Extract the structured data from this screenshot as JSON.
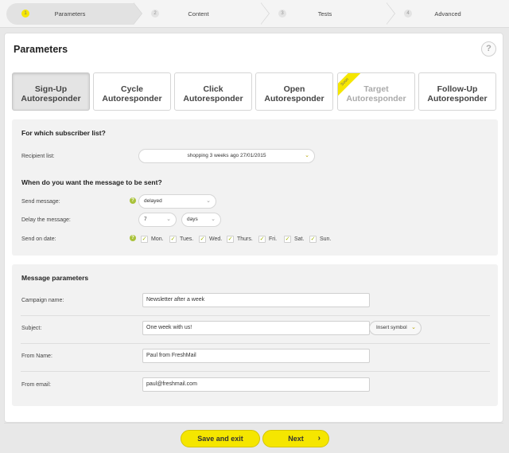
{
  "wizard": {
    "steps": [
      {
        "num": "1",
        "label": "Parameters"
      },
      {
        "num": "2",
        "label": "Content"
      },
      {
        "num": "3",
        "label": "Tests"
      },
      {
        "num": "4",
        "label": "Advanced"
      }
    ]
  },
  "page": {
    "title": "Parameters",
    "help_icon": "?"
  },
  "tiles": [
    {
      "line1": "Sign-Up",
      "line2": "Autoresponder"
    },
    {
      "line1": "Cycle",
      "line2": "Autoresponder"
    },
    {
      "line1": "Click",
      "line2": "Autoresponder"
    },
    {
      "line1": "Open",
      "line2": "Autoresponder"
    },
    {
      "line1": "Target",
      "line2": "Autoresponder",
      "ribbon": "Soon"
    },
    {
      "line1": "Follow-Up",
      "line2": "Autoresponder"
    }
  ],
  "list_section": {
    "title": "For which subscriber list?",
    "recipient_label": "Recipient list:",
    "recipient_value": "shopping 3 weeks ago 27/01/2015"
  },
  "timing_section": {
    "title": "When do you want the message to be sent?",
    "send_label": "Send message:",
    "send_value": "delayed",
    "delay_label": "Delay the message:",
    "delay_amount": "7",
    "delay_unit": "days",
    "date_label": "Send on date:",
    "days": [
      "Mon.",
      "Tues.",
      "Wed.",
      "Thurs.",
      "Fri.",
      "Sat.",
      "Sun."
    ]
  },
  "message_section": {
    "title": "Message parameters",
    "campaign_label": "Campaign name:",
    "campaign_value": "Newsletter after a week",
    "subject_label": "Subject:",
    "subject_value": "One week with us!",
    "insert_symbol": "Insert symbol",
    "from_name_label": "From Name:",
    "from_name_value": "Paul from FreshMail",
    "from_email_label": "From email:",
    "from_email_value": "paul@freshmail.com"
  },
  "footer": {
    "save_exit": "Save and exit",
    "next": "Next"
  },
  "colors": {
    "accent": "#f5e600",
    "info": "#a9c23a"
  }
}
